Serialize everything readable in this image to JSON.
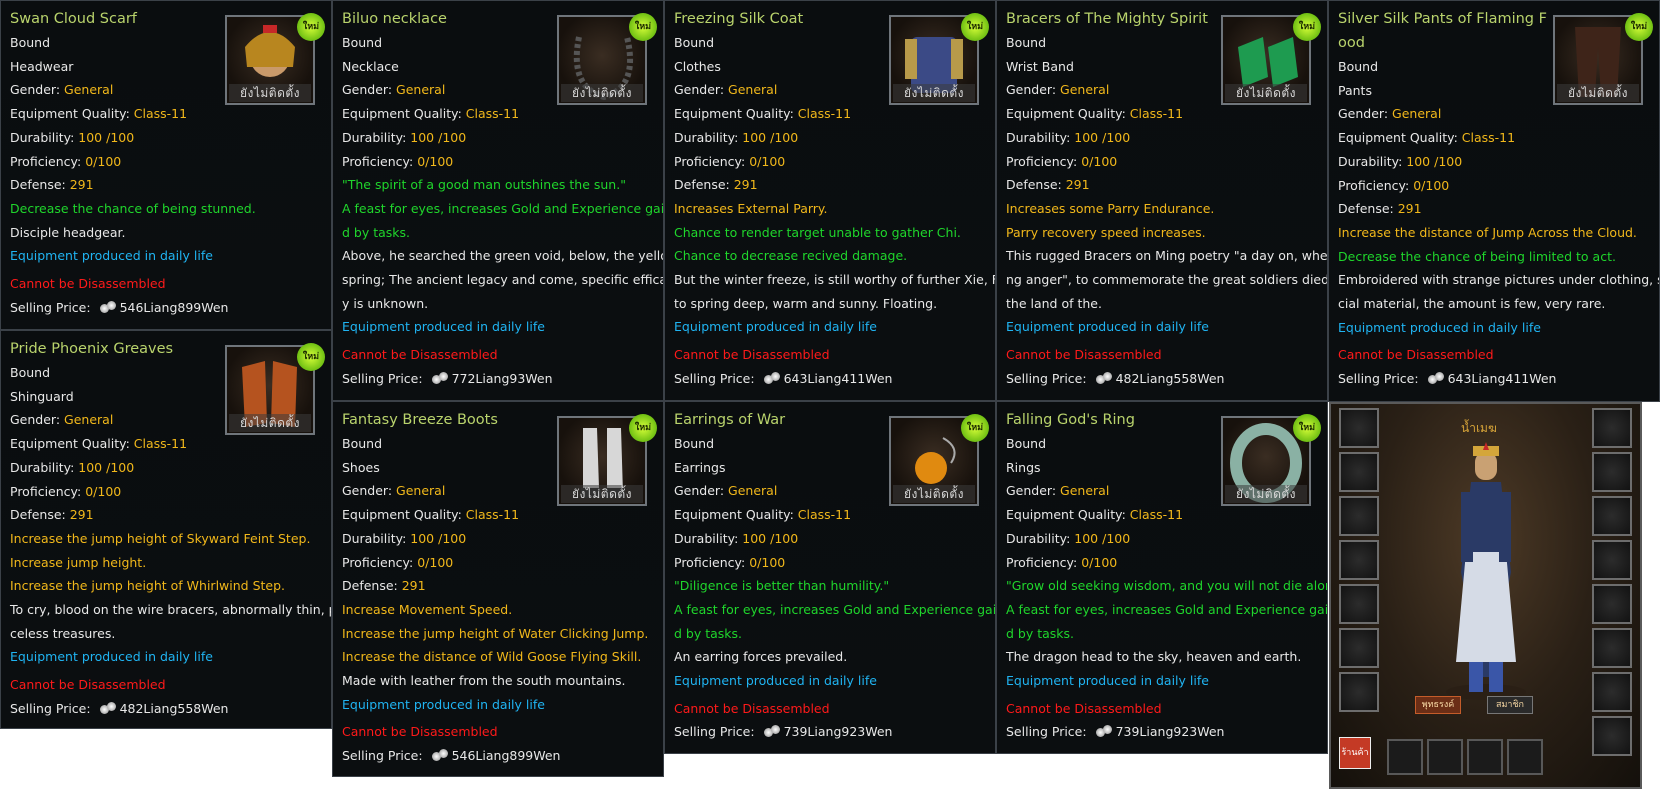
{
  "stamp_text": "ยังไม่ติดตั้ง",
  "badge_text": "ใหม่",
  "money_icon": "silver-coins-icon",
  "items": [
    {
      "title": "Swan Cloud Scarf",
      "lines": [
        {
          "t": "Bound",
          "c": "w"
        },
        {
          "t": "Headwear",
          "c": "w"
        },
        {
          "label": "Gender: ",
          "value": "General"
        },
        {
          "label": "Equipment Quality: ",
          "value": "Class-11"
        },
        {
          "label": "Durability: ",
          "value": "100 /100"
        },
        {
          "label": "Proficiency: ",
          "value": "0/100"
        },
        {
          "label": "Defense: ",
          "value": "291"
        },
        {
          "t": "Decrease the chance of being stunned.",
          "c": "g"
        },
        {
          "t": "Disciple headgear.",
          "c": "w"
        },
        {
          "t": "Equipment produced in daily life",
          "c": "b"
        },
        {
          "t": "Cannot be Disassembled",
          "c": "r",
          "gap": true
        },
        {
          "price": "546Liang899Wen"
        }
      ]
    },
    {
      "title": "Biluo necklace",
      "lines": [
        {
          "t": "Bound",
          "c": "w"
        },
        {
          "t": "Necklace",
          "c": "w"
        },
        {
          "label": "Gender: ",
          "value": "General"
        },
        {
          "label": "Equipment Quality: ",
          "value": "Class-11"
        },
        {
          "label": "Durability: ",
          "value": "100 /100"
        },
        {
          "label": "Proficiency: ",
          "value": "0/100"
        },
        {
          "t": "\"The spirit of a good man outshines the sun.\"",
          "c": "g"
        },
        {
          "t": "A feast for eyes, increases Gold and Experience gaine",
          "c": "g"
        },
        {
          "t": "d by tasks.",
          "c": "g"
        },
        {
          "t": "Above, he searched the green void, below, the yellow",
          "c": "w"
        },
        {
          "t": " spring; The ancient legacy and come, specific efficac",
          "c": "w"
        },
        {
          "t": "y is unknown.",
          "c": "w"
        },
        {
          "t": "Equipment produced in daily life",
          "c": "b"
        },
        {
          "t": "Cannot be Disassembled",
          "c": "r",
          "gap": true
        },
        {
          "price": "772Liang93Wen"
        }
      ]
    },
    {
      "title": "Freezing Silk Coat",
      "lines": [
        {
          "t": "Bound",
          "c": "w"
        },
        {
          "t": "Clothes",
          "c": "w"
        },
        {
          "label": "Gender: ",
          "value": "General"
        },
        {
          "label": "Equipment Quality: ",
          "value": "Class-11"
        },
        {
          "label": "Durability: ",
          "value": "100 /100"
        },
        {
          "label": "Proficiency: ",
          "value": "0/100"
        },
        {
          "label": "Defense: ",
          "value": "291"
        },
        {
          "t": "Increases External Parry.",
          "c": "y"
        },
        {
          "t": "Chance to render target unable to gather Chi.",
          "c": "g"
        },
        {
          "t": "Chance to decrease recived damage.",
          "c": "g"
        },
        {
          "t": "But the winter freeze, is still worthy of further Xie, Fu",
          "c": "w"
        },
        {
          "t": "to spring deep, warm and sunny. Floating.",
          "c": "w"
        },
        {
          "t": "Equipment produced in daily life",
          "c": "b"
        },
        {
          "t": "Cannot be Disassembled",
          "c": "r",
          "gap": true
        },
        {
          "price": "643Liang411Wen"
        }
      ]
    },
    {
      "title": "Bracers of The Mighty Spirit",
      "lines": [
        {
          "t": "Bound",
          "c": "w"
        },
        {
          "t": "Wrist Band",
          "c": "w"
        },
        {
          "label": "Gender: ",
          "value": "General"
        },
        {
          "label": "Equipment Quality: ",
          "value": "Class-11"
        },
        {
          "label": "Durability: ",
          "value": "100 /100"
        },
        {
          "label": "Proficiency: ",
          "value": "0/100"
        },
        {
          "label": "Defense: ",
          "value": "291"
        },
        {
          "t": "Increases some Parry Endurance.",
          "c": "y"
        },
        {
          "t": "Parry recovery speed increases.",
          "c": "y"
        },
        {
          "t": "This rugged Bracers on Ming poetry \"a day on, wheeli",
          "c": "w"
        },
        {
          "t": "ng anger\", to commemorate the great soldiers died in",
          "c": "w"
        },
        {
          "t": " the land of the.",
          "c": "w"
        },
        {
          "t": "Equipment produced in daily life",
          "c": "b"
        },
        {
          "t": "Cannot be Disassembled",
          "c": "r",
          "gap": true
        },
        {
          "price": "482Liang558Wen"
        }
      ]
    },
    {
      "title": "Silver Silk Pants of Flaming Food",
      "lines": [
        {
          "t": "Bound",
          "c": "w"
        },
        {
          "t": "Pants",
          "c": "w"
        },
        {
          "label": "Gender: ",
          "value": "General"
        },
        {
          "label": "Equipment Quality: ",
          "value": "Class-11"
        },
        {
          "label": "Durability: ",
          "value": "100 /100"
        },
        {
          "label": "Proficiency: ",
          "value": "0/100"
        },
        {
          "label": "Defense: ",
          "value": "291"
        },
        {
          "t": "Increase the distance of Jump Across the Cloud.",
          "c": "y"
        },
        {
          "t": "Decrease the chance of being limited to act.",
          "c": "g"
        },
        {
          "t": "Embroidered with strange pictures under clothing, spe",
          "c": "w"
        },
        {
          "t": "cial material, the amount is few, very rare.",
          "c": "w"
        },
        {
          "t": "Equipment produced in daily life",
          "c": "b"
        },
        {
          "t": "Cannot be Disassembled",
          "c": "r",
          "gap": true
        },
        {
          "price": "643Liang411Wen"
        }
      ]
    },
    {
      "title": "Pride Phoenix Greaves",
      "lines": [
        {
          "t": "Bound",
          "c": "w"
        },
        {
          "t": "Shinguard",
          "c": "w"
        },
        {
          "label": "Gender: ",
          "value": "General"
        },
        {
          "label": "Equipment Quality: ",
          "value": "Class-11"
        },
        {
          "label": "Durability: ",
          "value": "100 /100"
        },
        {
          "label": "Proficiency: ",
          "value": "0/100"
        },
        {
          "label": "Defense: ",
          "value": "291"
        },
        {
          "t": "Increase the jump height of Skyward Feint Step.",
          "c": "y"
        },
        {
          "t": "Increase jump height.",
          "c": "y"
        },
        {
          "t": "Increase the jump height of Whirlwind Step.",
          "c": "y"
        },
        {
          "t": "To cry, blood on the wire bracers, abnormally thin, pri",
          "c": "w"
        },
        {
          "t": "celess treasures.",
          "c": "w"
        },
        {
          "t": "Equipment produced in daily life",
          "c": "b"
        },
        {
          "t": "Cannot be Disassembled",
          "c": "r",
          "gap": true
        },
        {
          "price": "482Liang558Wen"
        }
      ]
    },
    {
      "title": "Fantasy Breeze Boots",
      "lines": [
        {
          "t": "Bound",
          "c": "w"
        },
        {
          "t": "Shoes",
          "c": "w"
        },
        {
          "label": "Gender: ",
          "value": "General"
        },
        {
          "label": "Equipment Quality: ",
          "value": "Class-11"
        },
        {
          "label": "Durability: ",
          "value": "100 /100"
        },
        {
          "label": "Proficiency: ",
          "value": "0/100"
        },
        {
          "label": "Defense: ",
          "value": "291"
        },
        {
          "t": "Increase Movement Speed.",
          "c": "y"
        },
        {
          "t": "Increase the jump height of Water Clicking Jump.",
          "c": "y"
        },
        {
          "t": "Increase the distance of Wild Goose Flying Skill.",
          "c": "y"
        },
        {
          "t": "Made with leather from the south mountains.",
          "c": "w"
        },
        {
          "t": "Equipment produced in daily life",
          "c": "b"
        },
        {
          "t": "Cannot be Disassembled",
          "c": "r",
          "gap": true
        },
        {
          "price": "546Liang899Wen"
        }
      ]
    },
    {
      "title": "Earrings of War",
      "lines": [
        {
          "t": "Bound",
          "c": "w"
        },
        {
          "t": "Earrings",
          "c": "w"
        },
        {
          "label": "Gender: ",
          "value": "General"
        },
        {
          "label": "Equipment Quality: ",
          "value": "Class-11"
        },
        {
          "label": "Durability: ",
          "value": "100 /100"
        },
        {
          "label": "Proficiency: ",
          "value": "0/100"
        },
        {
          "t": "\"Diligence is better than humility.\"",
          "c": "g"
        },
        {
          "t": "A feast for eyes, increases Gold and Experience gaine",
          "c": "g"
        },
        {
          "t": "d by tasks.",
          "c": "g"
        },
        {
          "t": "An earring forces prevailed.",
          "c": "w"
        },
        {
          "t": "Equipment produced in daily life",
          "c": "b"
        },
        {
          "t": "Cannot be Disassembled",
          "c": "r",
          "gap": true
        },
        {
          "price": "739Liang923Wen"
        }
      ]
    },
    {
      "title": "Falling God's Ring",
      "lines": [
        {
          "t": "Bound",
          "c": "w"
        },
        {
          "t": "Rings",
          "c": "w"
        },
        {
          "label": "Gender: ",
          "value": "General"
        },
        {
          "label": "Equipment Quality: ",
          "value": "Class-11"
        },
        {
          "label": "Durability: ",
          "value": "100 /100"
        },
        {
          "label": "Proficiency: ",
          "value": "0/100"
        },
        {
          "t": "\"Grow old seeking wisdom, and you will not die alone.\"",
          "c": "g"
        },
        {
          "t": "A feast for eyes, increases Gold and Experience gaine",
          "c": "g"
        },
        {
          "t": "d by tasks.",
          "c": "g"
        },
        {
          "t": "The dragon head to the sky, heaven and earth.",
          "c": "w"
        },
        {
          "t": "Equipment produced in daily life",
          "c": "b"
        },
        {
          "t": "Cannot be Disassembled",
          "c": "r",
          "gap": true
        },
        {
          "price": "739Liang923Wen"
        }
      ]
    }
  ],
  "price_label": "Selling Price: ",
  "character": {
    "name": "น้ำเมฆ",
    "btn_left": "พุทธรงค์",
    "btn_right": "สมาชิก",
    "shop_label": "ร้านค้า"
  }
}
